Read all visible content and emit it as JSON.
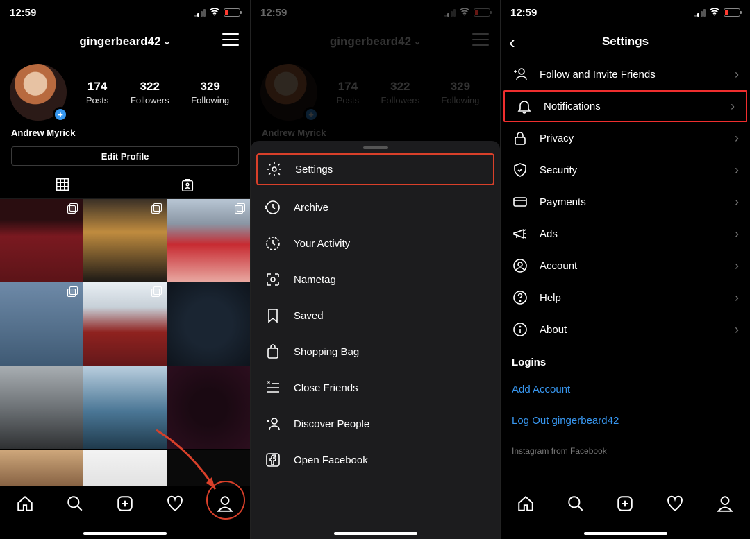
{
  "status": {
    "time": "12:59"
  },
  "panel1": {
    "username": "gingerbeard42",
    "display_name": "Andrew Myrick",
    "edit_label": "Edit Profile",
    "stats": {
      "posts": {
        "value": "174",
        "label": "Posts"
      },
      "followers": {
        "value": "322",
        "label": "Followers"
      },
      "following": {
        "value": "329",
        "label": "Following"
      }
    }
  },
  "panel2": {
    "username": "gingerbeard42",
    "display_name": "Andrew Myrick",
    "stats": {
      "posts": {
        "value": "174",
        "label": "Posts"
      },
      "followers": {
        "value": "322",
        "label": "Followers"
      },
      "following": {
        "value": "329",
        "label": "Following"
      }
    },
    "menu": {
      "settings": "Settings",
      "archive": "Archive",
      "your_activity": "Your Activity",
      "nametag": "Nametag",
      "saved": "Saved",
      "shopping_bag": "Shopping Bag",
      "close_friends": "Close Friends",
      "discover_people": "Discover People",
      "open_facebook": "Open Facebook"
    }
  },
  "panel3": {
    "title": "Settings",
    "items": {
      "follow_invite": "Follow and Invite Friends",
      "notifications": "Notifications",
      "privacy": "Privacy",
      "security": "Security",
      "payments": "Payments",
      "ads": "Ads",
      "account": "Account",
      "help": "Help",
      "about": "About"
    },
    "logins_label": "Logins",
    "add_account": "Add Account",
    "log_out": "Log Out gingerbeard42",
    "footer": "Instagram from Facebook"
  },
  "grid_styles": [
    "linear-gradient(#2a0d10 25%,#7a1920 45%,#5c1418 100%)",
    "linear-gradient(#3a3026 0%,#c08c3f 40%,#1e1a16 100%)",
    "linear-gradient(#b8c6d4 0%,#8a96a4 30%,#c72b32 55%,#e8a7a0 100%)",
    "linear-gradient(#6e8aa8 0%,#3f5a74 100%)",
    "linear-gradient(#e8eef3 0%,#c7d0d8 30%,#8f221f 60%,#64181a 100%)",
    "radial-gradient(circle,#1a2532 0 40%,#0e141c 100%)",
    "linear-gradient(#a8aeb2 0%,#6d7276 50%,#2f3133 100%)",
    "linear-gradient(#b9cede 0%,#4a7695 55%,#1f3a4c 100%)",
    "radial-gradient(circle,#1a0912 0 30%,#2c0e1e 100%)",
    "linear-gradient(#cfa87c 0%,#6e4a2f 60%,#2e1d13 100%)",
    "linear-gradient(#f3f3f3 0%,#dcdcdc 60%,#9a9a9a 100%)",
    "#0a0a0a"
  ],
  "multi_badge_indexes": [
    0,
    1,
    2,
    3,
    4
  ]
}
